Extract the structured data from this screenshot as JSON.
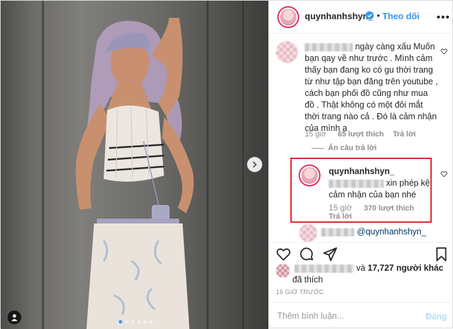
{
  "header": {
    "username": "quynhanhshyn_",
    "separator": "•",
    "follow_label": "Theo dõi",
    "more_label": "•••"
  },
  "comments": [
    {
      "text": "ngày càng xấu Muốn bạn qay về như trước . Mình cảm thấy bạn đang ko có gu thời trang từ như tập bạn đăng trên youtube , cách bạn phối đồ cũng như mua đồ . Thật không có một đôi mắt thời trang nào cả . Đó là cảm nhận của mình ạ",
      "time": "15 giờ",
      "likes": "65 lượt thích",
      "reply": "Trả lời",
      "hide_replies": "Ẩn câu trả lời"
    }
  ],
  "reply": {
    "username": "quynhanhshyn_",
    "text": "xin phép kệ cảm nhận của bạn nhé",
    "time": "15 giờ",
    "likes": "370 lượt thích",
    "reply": "Trả lời"
  },
  "next_comment": {
    "mention": "@quynhanhshyn_"
  },
  "likes_summary": {
    "connector": "và",
    "others": "17,727 người khác",
    "suffix": "đã thích"
  },
  "timestamp": "16 GIỜ TRƯỚC",
  "composer": {
    "placeholder": "Thêm bình luận...",
    "post_label": "Đăng"
  },
  "carousel": {
    "count": 6,
    "active_index": 0
  },
  "colors": {
    "accent": "#3897f0",
    "highlight_border": "#e0282c",
    "meta_text": "#8e8e8e"
  }
}
